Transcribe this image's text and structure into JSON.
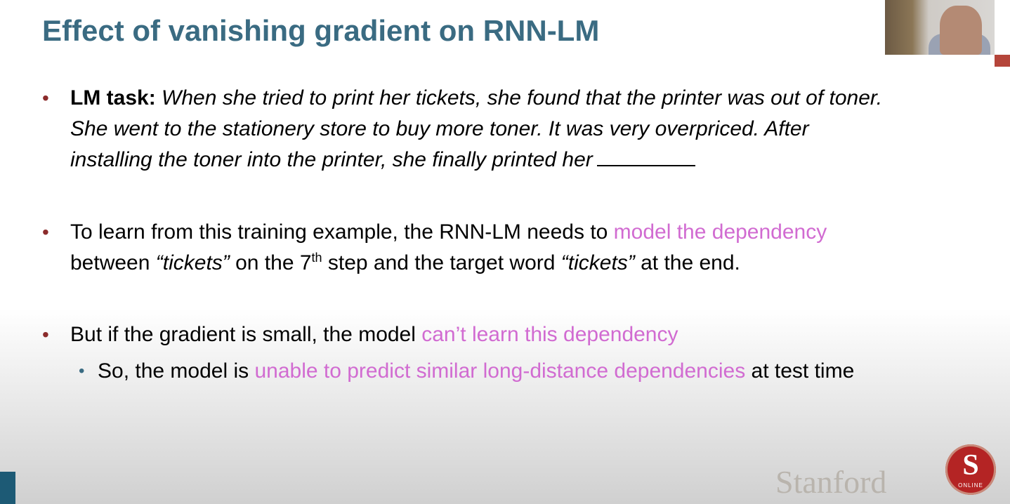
{
  "slide": {
    "title": "Effect of vanishing gradient on RNN-LM",
    "bullet1": {
      "label": "LM task:",
      "line1": "When she tried to print her tickets, she found that the printer was out of toner.",
      "line2": "She went to the stationery store to buy more toner. It was very overpriced. After",
      "line3": "installing the toner into the printer, she finally printed her"
    },
    "bullet2": {
      "part1": "To learn from this training example, the RNN-LM needs to ",
      "highlight": "model the dependency",
      "part2": "between ",
      "word1": "“tickets”",
      "part3": " on the 7",
      "sup": "th",
      "part4": " step and the target word ",
      "word2": "“tickets”",
      "part5": " at the end."
    },
    "bullet3": {
      "part1": "But if the gradient is small, the model ",
      "highlight": "can’t learn this dependency"
    },
    "sub_bullet": {
      "part1": "So, the model is ",
      "highlight": "unable to predict similar long-distance dependencies",
      "part2": " at test time"
    },
    "footer": {
      "wordmark": "Stanford",
      "seal_letter": "S",
      "seal_text": "ONLINE"
    }
  },
  "colors": {
    "title": "#3a6b82",
    "highlight": "#d16bd1",
    "bullet": "#8b2b2b"
  }
}
